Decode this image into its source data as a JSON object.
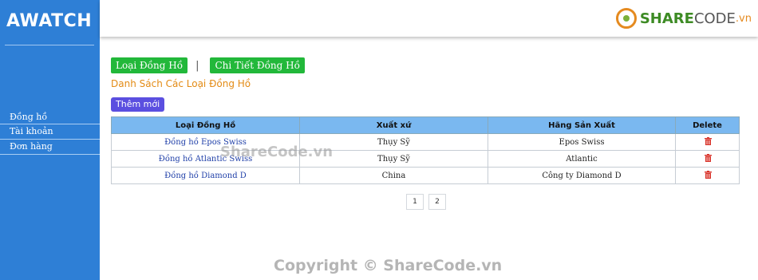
{
  "sidebar": {
    "logo": "AWATCH",
    "items": [
      {
        "label": "Đồng hồ"
      },
      {
        "label": "Tài khoản"
      },
      {
        "label": "Đơn hàng"
      }
    ]
  },
  "header": {
    "brand_main": "SHARE",
    "brand_secondary": "CODE",
    "brand_suffix": ".vn"
  },
  "tabs": {
    "loai_label": "Loại Đồng Hồ",
    "separator": "|",
    "chitiet_label": "Chi Tiết Đồng Hồ"
  },
  "page_title": "Danh Sách Các Loại Đồng Hồ",
  "add_button": "Thêm mới",
  "table": {
    "headers": [
      "Loại Đồng Hồ",
      "Xuất xứ",
      "Hãng Sản Xuất",
      "Delete"
    ],
    "rows": [
      {
        "name": "Đồng hồ Epos Swiss",
        "origin": "Thụy Sỹ",
        "maker": "Epos Swiss"
      },
      {
        "name": "Đồng hồ Atlantic Swiss",
        "origin": "Thụy Sỹ",
        "maker": "Atlantic"
      },
      {
        "name": "Đồng hồ Diamond D",
        "origin": "China",
        "maker": "Công ty Diamond D"
      }
    ]
  },
  "pagination": {
    "pages": [
      "1",
      "2"
    ]
  },
  "watermarks": {
    "center": "ShareCode.vn",
    "bottom": "Copyright © ShareCode.vn"
  },
  "colors": {
    "sidebar": "#2e7fd6",
    "tab_green": "#22b83a",
    "title_orange": "#e38b15",
    "add_purple": "#5b4fe0",
    "table_header": "#7ab8f0",
    "delete_red": "#d9342b"
  },
  "icons": {
    "delete": "trash-icon"
  }
}
